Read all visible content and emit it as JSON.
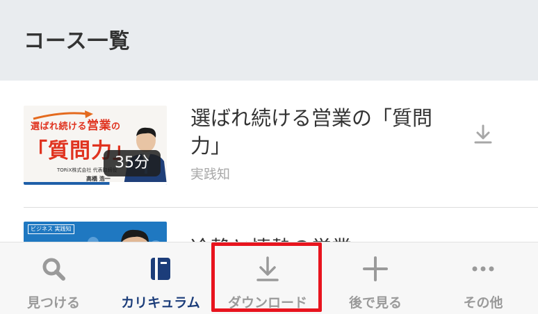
{
  "header": {
    "title": "コース一覧"
  },
  "courses": [
    {
      "title": "選ばれ続ける営業の「質問力」",
      "category": "実践知",
      "duration": "35分",
      "thumbnail": {
        "tag_prefix": "選ばれ続ける",
        "tag_accent": "営業",
        "tag_suffix": "の",
        "big_text": "「質問力」",
        "company": "TORiX株式会社 代表取締役",
        "name": "高橋 浩一"
      }
    },
    {
      "title": "冷静と情熱の営業",
      "thumbnail": {
        "label": "ビジネス 実践知"
      }
    }
  ],
  "tabbar": {
    "items": [
      {
        "label": "見つける",
        "icon": "search-icon"
      },
      {
        "label": "カリキュラム",
        "icon": "notebook-icon",
        "active": true
      },
      {
        "label": "ダウンロード",
        "icon": "download-icon"
      },
      {
        "label": "後で見る",
        "icon": "plus-icon"
      },
      {
        "label": "その他",
        "icon": "more-icon"
      }
    ]
  },
  "colors": {
    "header_bg": "#e9ecef",
    "active_tab": "#1c3d7a",
    "inactive_tab": "#9a9a9a",
    "highlight": "#e8141e",
    "badge_bg": "#1e1e1e"
  }
}
